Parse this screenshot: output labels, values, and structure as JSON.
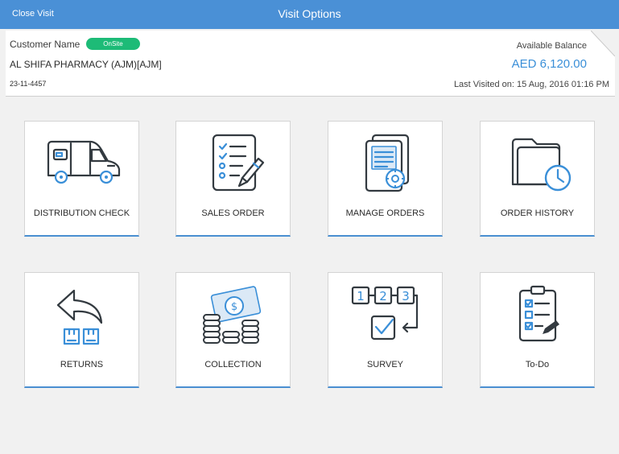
{
  "topbar": {
    "close_label": "Close Visit",
    "title": "Visit Options",
    "color": "#4a90d6"
  },
  "customer": {
    "name_label": "Customer Name",
    "status_badge": "OnSite",
    "name": "AL SHIFA PHARMACY (AJM)[AJM]",
    "code": "23-11-4457",
    "balance_label": "Available Balance",
    "balance_value": "AED 6,120.00",
    "last_visited": "Last Visited on: 15 Aug, 2016 01:16 PM"
  },
  "tiles": [
    {
      "label": "DISTRIBUTION CHECK",
      "icon": "van-icon"
    },
    {
      "label": "SALES ORDER",
      "icon": "checklist-pencil-icon"
    },
    {
      "label": "MANAGE ORDERS",
      "icon": "document-gear-icon"
    },
    {
      "label": "ORDER HISTORY",
      "icon": "folder-clock-icon"
    },
    {
      "label": "RETURNS",
      "icon": "return-arrow-boxes-icon"
    },
    {
      "label": "COLLECTION",
      "icon": "coins-banknote-icon"
    },
    {
      "label": "SURVEY",
      "icon": "steps-checkbox-icon"
    },
    {
      "label": "To-Do",
      "icon": "clipboard-checklist-icon"
    }
  ],
  "colors": {
    "accent": "#3a8fd8",
    "badge": "#1dbb77",
    "icon_ink": "#333a40"
  }
}
